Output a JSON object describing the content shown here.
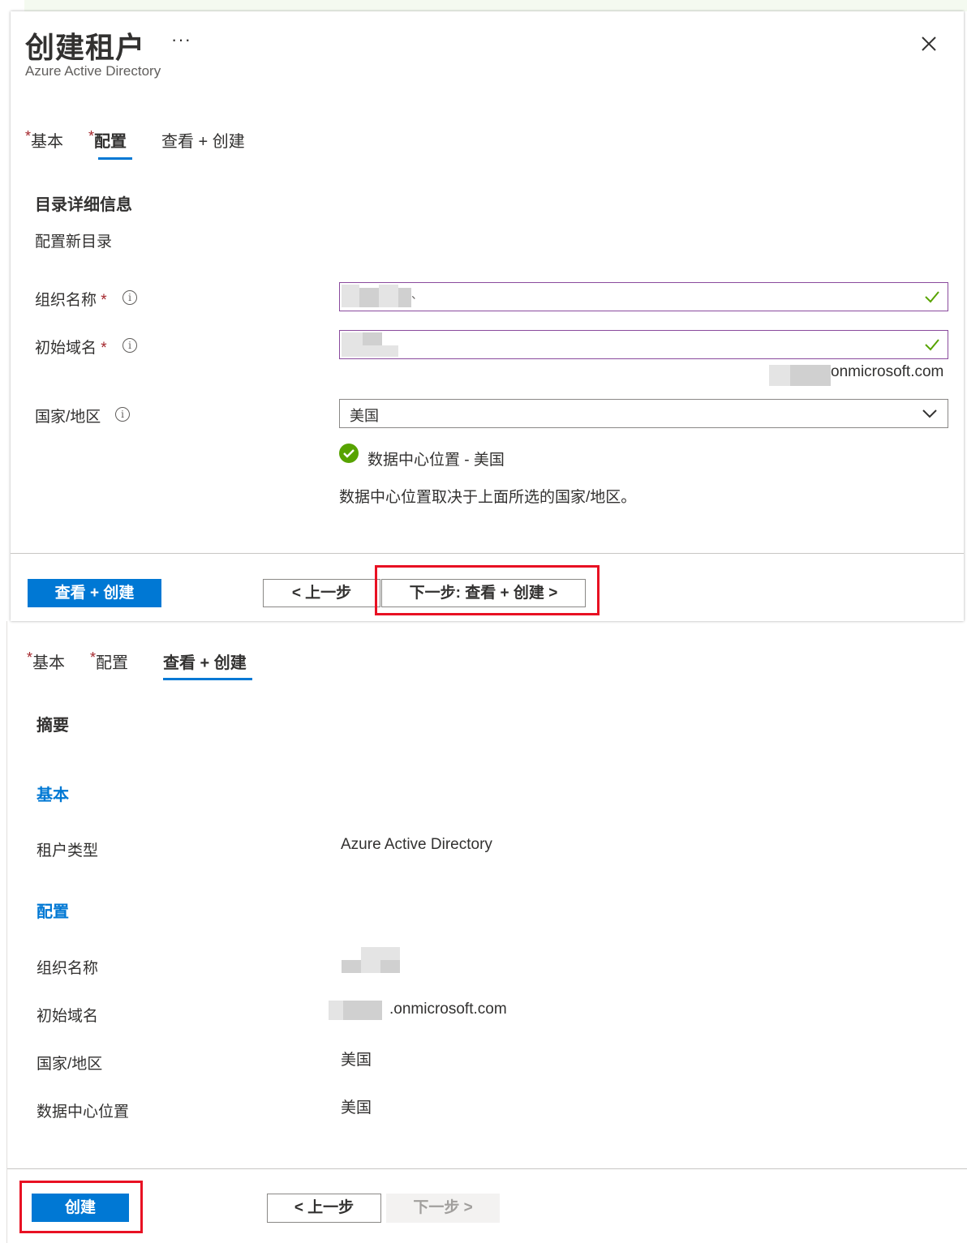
{
  "panel1": {
    "title": "创建租户",
    "more": "···",
    "subtitle": "Azure Active Directory",
    "tabs": [
      {
        "label": "基本",
        "required": "*"
      },
      {
        "label": "配置",
        "required": "*"
      },
      {
        "label": "查看 + 创建",
        "required": ""
      }
    ],
    "section_title": "目录详细信息",
    "section_desc": "配置新目录",
    "fields": {
      "org_name_label": "组织名称",
      "domain_label": "初始域名",
      "country_label": "国家/地区",
      "required_mark": "*",
      "info_glyph": "i",
      "domain_suffix": "onmicrosoft.com",
      "country_value": "美国",
      "org_name_tail": "、"
    },
    "datacenter_status": "数据中心位置 - 美国",
    "datacenter_note": "数据中心位置取决于上面所选的国家/地区。",
    "buttons": {
      "review_create": "查看 + 创建",
      "prev": "< 上一步",
      "next": "下一步: 查看 + 创建 >"
    }
  },
  "panel2": {
    "tabs": [
      {
        "label": "基本",
        "required": "*"
      },
      {
        "label": "配置",
        "required": "*"
      },
      {
        "label": "查看 + 创建",
        "required": ""
      }
    ],
    "summary_title": "摘要",
    "basic_title": "基本",
    "tenant_type_label": "租户类型",
    "tenant_type_value": "Azure Active Directory",
    "config_title": "配置",
    "org_name_label": "组织名称",
    "domain_label": "初始域名",
    "domain_value_suffix": ".onmicrosoft.com",
    "country_label": "国家/地区",
    "country_value": "美国",
    "datacenter_label": "数据中心位置",
    "datacenter_value": "美国",
    "buttons": {
      "create": "创建",
      "prev": "< 上一步",
      "next": "下一步 >"
    }
  },
  "colors": {
    "accent": "#0078d4",
    "highlight_box": "#e81123",
    "success": "#57a300",
    "required": "#a4262c"
  }
}
